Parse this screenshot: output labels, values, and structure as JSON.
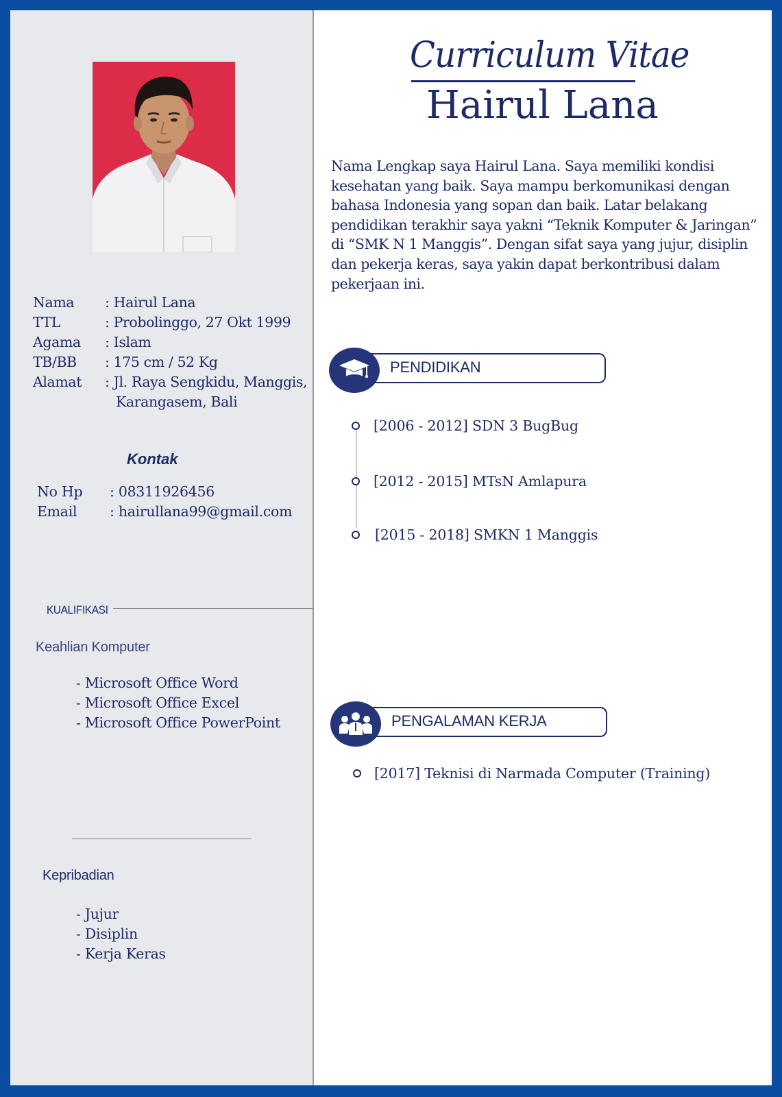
{
  "header": {
    "script_title": "Curriculum Vitae",
    "name": "Hairul Lana"
  },
  "summary": "Nama Lengkap saya Hairul Lana. Saya memiliki kondisi kesehatan yang baik. Saya mampu berkomunikasi dengan bahasa Indonesia yang sopan dan baik. Latar belakang pendidikan terakhir saya yakni “Teknik Komputer & Jaringan” di “SMK N 1 Manggis”. Dengan sifat saya yang jujur, disiplin dan pekerja keras, saya yakin dapat berkontribusi dalam pekerjaan ini.",
  "personal": {
    "nama_label": "Nama",
    "nama_value": ": Hairul Lana",
    "ttl_label": "TTL",
    "ttl_value": ": Probolinggo, 27 Okt 1999",
    "agama_label": "Agama",
    "agama_value": ": Islam",
    "tbbb_label": "TB/BB",
    "tbbb_value": ": 175 cm / 52 Kg",
    "alamat_label": "Alamat",
    "alamat_value": ": Jl. Raya Sengkidu, Manggis,",
    "alamat_value_2": "Karangasem, Bali"
  },
  "kontak": {
    "title": "Kontak",
    "hp_label": "No Hp",
    "hp_value": ": 08311926456",
    "email_label": "Email",
    "email_value": ": hairullana99@gmail.com"
  },
  "kualifikasi": {
    "title": "KUALIFIKASI",
    "keahlian_title": "Keahlian Komputer",
    "skills": [
      "- Microsoft Office Word",
      "- Microsoft Office Excel",
      "- Microsoft Office PowerPoint"
    ]
  },
  "kepribadian": {
    "title": "Kepribadian",
    "traits": [
      "- Jujur",
      "- Disiplin",
      "- Kerja Keras"
    ]
  },
  "pendidikan": {
    "title": "PENDIDIKAN",
    "icon": "graduation-cap-icon",
    "items": [
      "[2006 - 2012] SDN 3 BugBug",
      "[2012 - 2015] MTsN Amlapura",
      "[2015 - 2018] SMKN 1 Manggis"
    ]
  },
  "pengalaman": {
    "title": "PENGALAMAN KERJA",
    "icon": "team-icon",
    "items": [
      "[2017] Teknisi di Narmada Computer (Training)"
    ]
  },
  "colors": {
    "frame": "#0a4ea2",
    "navy": "#1d2a66",
    "photo_bg": "#db2c48",
    "left_panel": "#e8e9ec"
  }
}
